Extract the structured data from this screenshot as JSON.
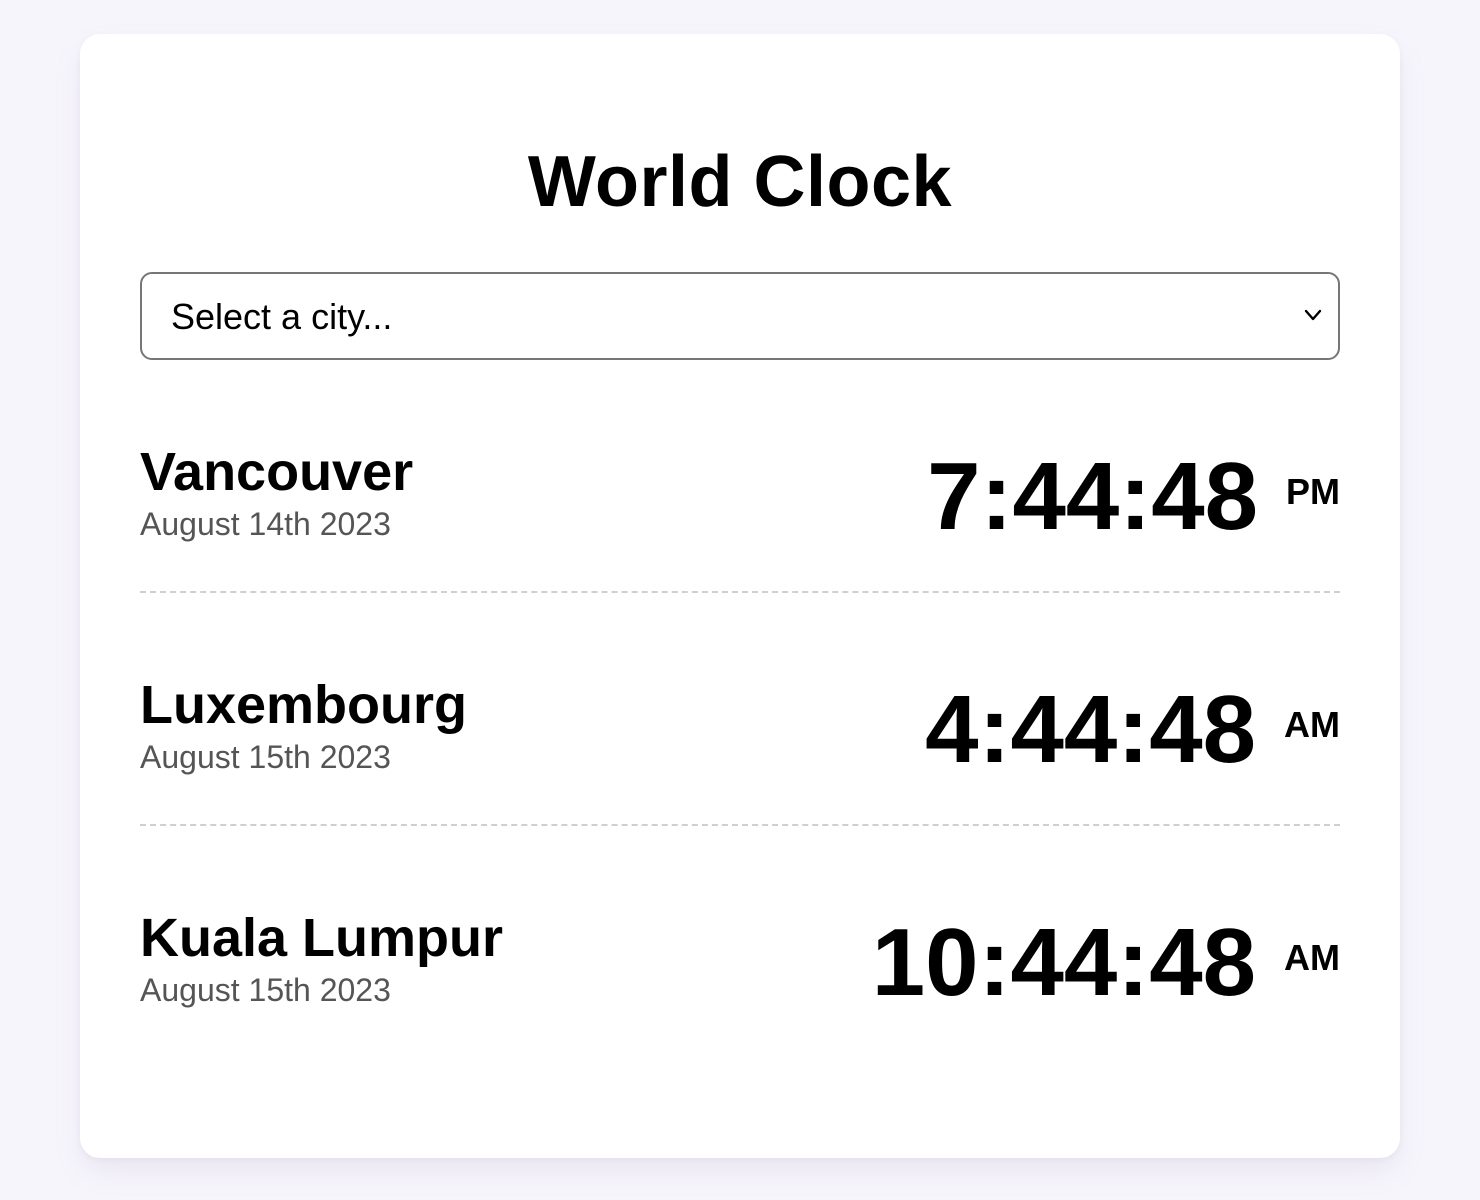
{
  "page": {
    "title": "World Clock"
  },
  "city_select": {
    "selected_label": "Select a city...",
    "icon": "chevron-down-icon"
  },
  "cities": [
    {
      "name": "Vancouver",
      "date": "August 14th 2023",
      "time": "7:44:48",
      "period": "PM"
    },
    {
      "name": "Luxembourg",
      "date": "August 15th 2023",
      "time": "4:44:48",
      "period": "AM"
    },
    {
      "name": "Kuala Lumpur",
      "date": "August 15th 2023",
      "time": "10:44:48",
      "period": "AM"
    }
  ],
  "colors": {
    "background": "#f7f5fc",
    "card": "#ffffff",
    "date_text": "#555555",
    "divider": "#cfcfcf",
    "select_border": "#767676"
  }
}
